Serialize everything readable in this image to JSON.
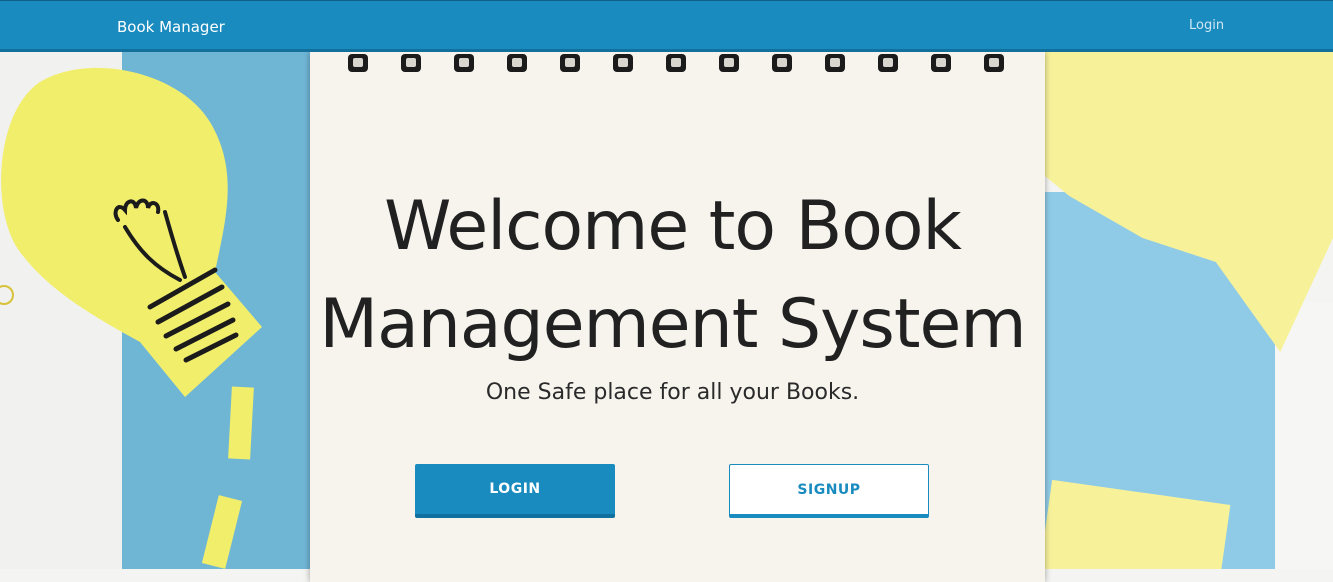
{
  "navbar": {
    "brand": "Book Manager",
    "login_link": "Login"
  },
  "hero": {
    "title_line1": "Welcome to Book",
    "title_line2": "Management System",
    "subtitle": "One Safe place for all your Books.",
    "login_button": "LOGIN",
    "signup_button": "SIGNUP"
  },
  "colors": {
    "primary": "#1a8bbf",
    "primary_dark": "#10709e",
    "text": "#212121"
  },
  "icons": [
    "lightbulb-illustration",
    "spiral-binding"
  ]
}
